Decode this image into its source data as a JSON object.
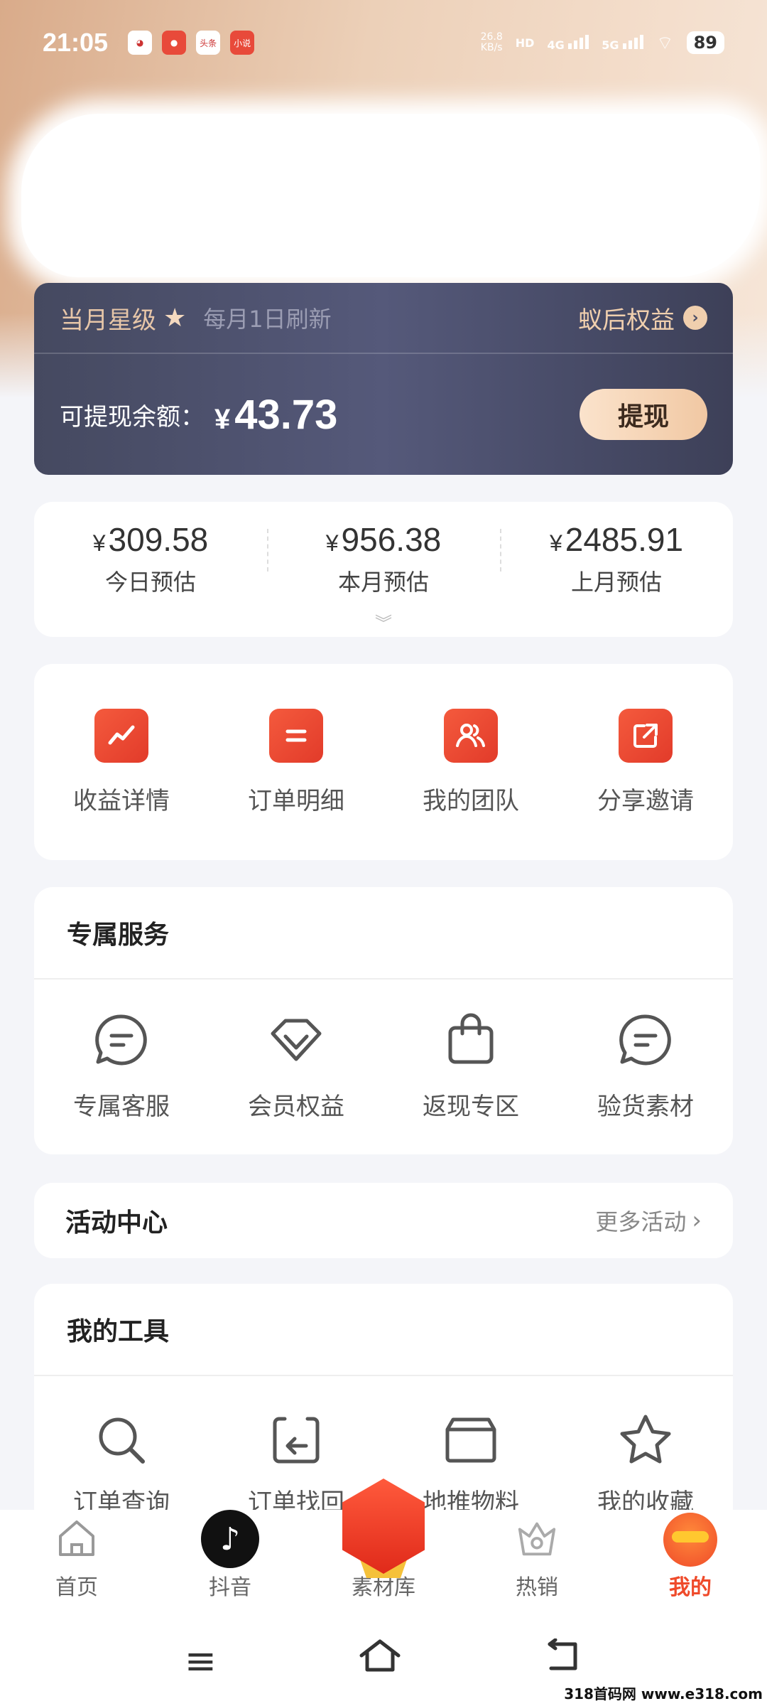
{
  "status_bar": {
    "time": "21:05",
    "net_speed_value": "26.8",
    "net_speed_unit": "KB/s",
    "hd": "HD",
    "sig1": "4G",
    "sig2": "5G",
    "battery": "89",
    "apps": [
      "",
      "",
      "头条",
      "小说"
    ]
  },
  "vip": {
    "level_label": "当月星级",
    "refresh_note": "每月1日刷新",
    "rights_label": "蚁后权益",
    "balance_label": "可提现余额：",
    "currency": "¥",
    "balance_value": "43.73",
    "withdraw_label": "提现"
  },
  "estimates": [
    {
      "currency": "¥",
      "value": "309.58",
      "label": "今日预估"
    },
    {
      "currency": "¥",
      "value": "956.38",
      "label": "本月预估"
    },
    {
      "currency": "¥",
      "value": "2485.91",
      "label": "上月预估"
    }
  ],
  "quick_actions": [
    {
      "label": "收益详情",
      "icon": "trend-chart-icon"
    },
    {
      "label": "订单明细",
      "icon": "list-icon"
    },
    {
      "label": "我的团队",
      "icon": "team-icon"
    },
    {
      "label": "分享邀请",
      "icon": "share-icon"
    }
  ],
  "services": {
    "title": "专属服务",
    "items": [
      {
        "label": "专属客服",
        "icon": "chat-bubble-icon"
      },
      {
        "label": "会员权益",
        "icon": "diamond-icon"
      },
      {
        "label": "返现专区",
        "icon": "shopping-bag-icon"
      },
      {
        "label": "验货素材",
        "icon": "chat-bubble-icon"
      }
    ]
  },
  "activity": {
    "title": "活动中心",
    "more_label": "更多活动"
  },
  "tools": {
    "title": "我的工具",
    "items": [
      {
        "label": "订单查询",
        "icon": "search-icon"
      },
      {
        "label": "订单找回",
        "icon": "return-icon"
      },
      {
        "label": "地推物料",
        "icon": "folder-icon"
      },
      {
        "label": "我的收藏",
        "icon": "star-icon"
      }
    ]
  },
  "bottom_nav": [
    {
      "label": "首页",
      "icon": "home-icon"
    },
    {
      "label": "抖音",
      "icon": "tiktok-icon"
    },
    {
      "label": "素材库",
      "icon": "material-library-icon"
    },
    {
      "label": "热销",
      "icon": "hot-sale-icon"
    },
    {
      "label": "我的",
      "icon": "mine-icon",
      "active": true
    }
  ],
  "watermark": "318首码网 www.e318.com",
  "colors": {
    "accent": "#ef4a2a",
    "card_dark": "#4a4d66",
    "gold": "#f0cfae"
  }
}
